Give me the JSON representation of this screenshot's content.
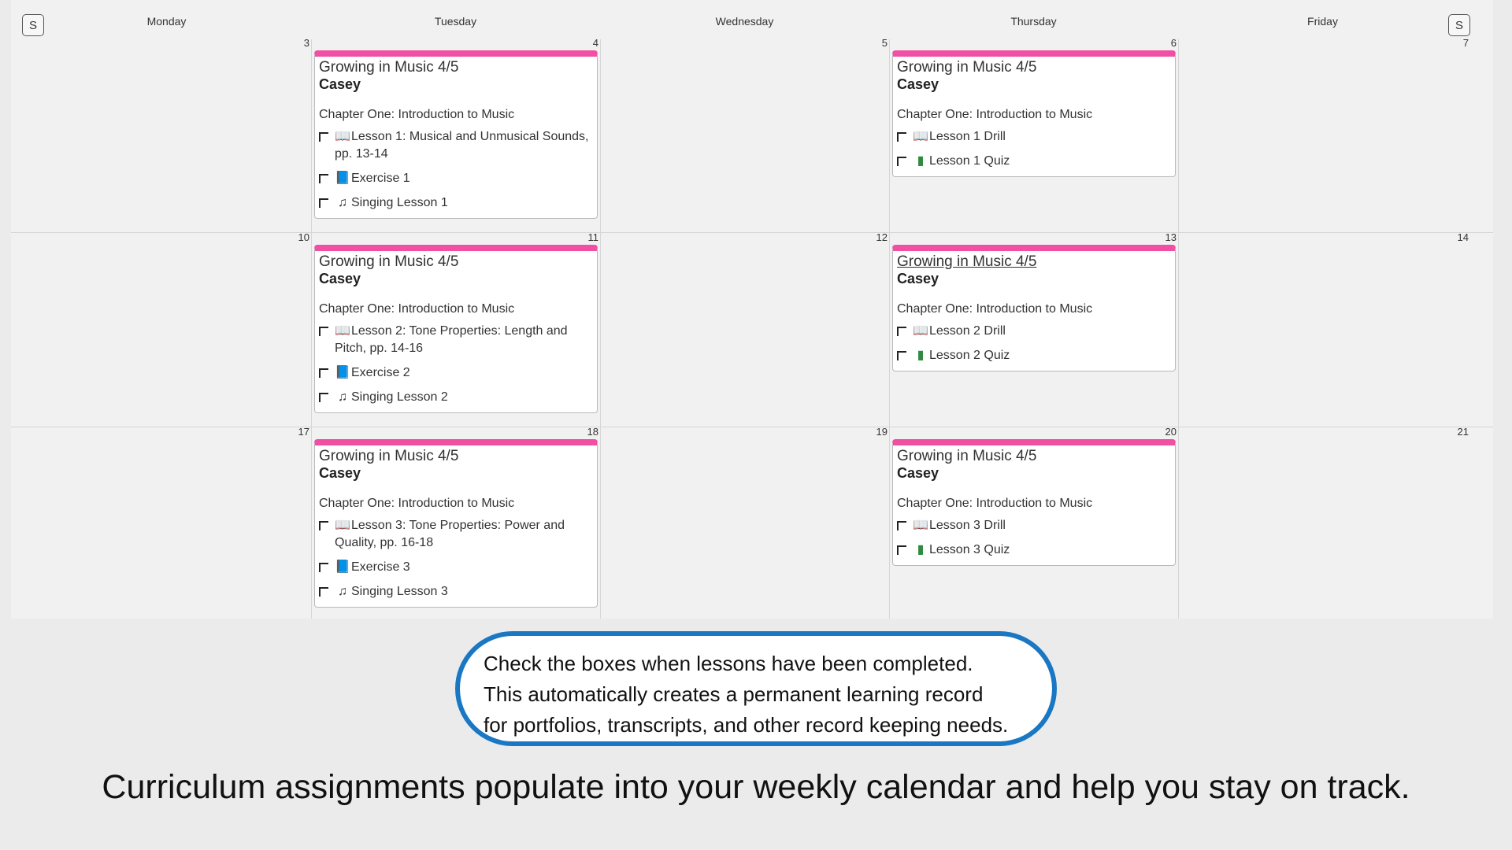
{
  "nav": {
    "prev_label": "S",
    "next_label": "S"
  },
  "days": [
    "Monday",
    "Tuesday",
    "Wednesday",
    "Thursday",
    "Friday"
  ],
  "weeks": [
    {
      "dates": [
        "3",
        "4",
        "5",
        "6",
        "7"
      ]
    },
    {
      "dates": [
        "10",
        "11",
        "12",
        "13",
        "14"
      ]
    },
    {
      "dates": [
        "17",
        "18",
        "19",
        "20",
        "21"
      ]
    }
  ],
  "events": [
    {
      "title": "Growing in Music 4/5",
      "student": "Casey",
      "chapter": "Chapter One: Introduction to Music",
      "items": [
        {
          "icon": "book-icon",
          "glyph": "📖",
          "text": "Lesson 1: Musical and Unmusical Sounds, pp. 13-14"
        },
        {
          "icon": "blue-book-icon",
          "glyph": "📘",
          "text": "Exercise 1"
        },
        {
          "icon": "music-note-icon",
          "glyph": "♫",
          "text": "Singing Lesson 1"
        }
      ]
    },
    {
      "title": "Growing in Music 4/5",
      "student": "Casey",
      "chapter": "Chapter One: Introduction to Music",
      "items": [
        {
          "icon": "book-icon",
          "glyph": "📖",
          "text": "Lesson 1 Drill"
        },
        {
          "icon": "chart-icon",
          "glyph": "▮",
          "text": "Lesson 1 Quiz"
        }
      ]
    },
    {
      "title": "Growing in Music 4/5",
      "student": "Casey",
      "chapter": "Chapter One: Introduction to Music",
      "items": [
        {
          "icon": "book-icon",
          "glyph": "📖",
          "text": "Lesson 2: Tone Properties: Length and Pitch, pp. 14-16"
        },
        {
          "icon": "blue-book-icon",
          "glyph": "📘",
          "text": "Exercise 2"
        },
        {
          "icon": "music-note-icon",
          "glyph": "♫",
          "text": "Singing Lesson 2"
        }
      ]
    },
    {
      "title": "Growing in Music 4/5",
      "student": "Casey",
      "chapter": "Chapter One: Introduction to Music",
      "items": [
        {
          "icon": "book-icon",
          "glyph": "📖",
          "text": "Lesson 2 Drill"
        },
        {
          "icon": "chart-icon",
          "glyph": "▮",
          "text": "Lesson 2 Quiz"
        }
      ]
    },
    {
      "title": "Growing in Music 4/5",
      "student": "Casey",
      "chapter": "Chapter One: Introduction to Music",
      "items": [
        {
          "icon": "book-icon",
          "glyph": "📖",
          "text": "Lesson 3: Tone Properties: Power and Quality, pp. 16-18"
        },
        {
          "icon": "blue-book-icon",
          "glyph": "📘",
          "text": "Exercise 3"
        },
        {
          "icon": "music-note-icon",
          "glyph": "♫",
          "text": "Singing Lesson 3"
        }
      ]
    },
    {
      "title": "Growing in Music 4/5",
      "student": "Casey",
      "chapter": "Chapter One: Introduction to Music",
      "items": [
        {
          "icon": "book-icon",
          "glyph": "📖",
          "text": "Lesson 3 Drill"
        },
        {
          "icon": "chart-icon",
          "glyph": "▮",
          "text": "Lesson 3 Quiz"
        }
      ]
    }
  ],
  "callout": {
    "line1": "Check the boxes when lessons have been completed.",
    "line2": "This automatically creates a permanent learning record",
    "line3": "for portfolios, transcripts, and other record keeping needs."
  },
  "caption": "Curriculum assignments populate into your weekly calendar and help you stay on track.",
  "colors": {
    "event_accent": "#f04fa3",
    "callout_border": "#1a77c3"
  }
}
